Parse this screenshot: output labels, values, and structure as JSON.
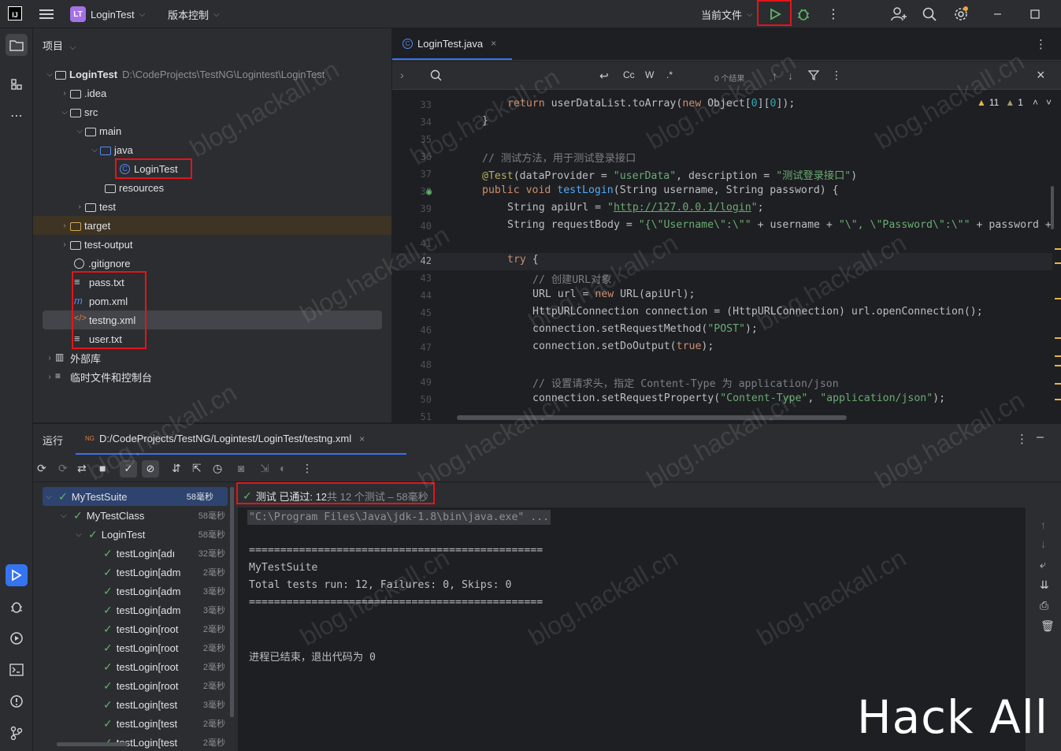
{
  "titlebar": {
    "project_badge": "LT",
    "project_name": "LoginTest",
    "vcs": "版本控制",
    "run_config": "当前文件"
  },
  "project": {
    "title": "项目",
    "tree": [
      {
        "label": "LoginTest",
        "path": "D:\\CodeProjects\\TestNG\\Logintest\\LoginTest"
      },
      {
        "label": ".idea"
      },
      {
        "label": "src"
      },
      {
        "label": "main"
      },
      {
        "label": "java"
      },
      {
        "label": "LoginTest"
      },
      {
        "label": "resources"
      },
      {
        "label": "test"
      },
      {
        "label": "target"
      },
      {
        "label": "test-output"
      },
      {
        "label": ".gitignore"
      },
      {
        "label": "pass.txt"
      },
      {
        "label": "pom.xml"
      },
      {
        "label": "testng.xml"
      },
      {
        "label": "user.txt"
      },
      {
        "label": "外部库"
      },
      {
        "label": "临时文件和控制台"
      }
    ]
  },
  "editor": {
    "tab": "LoginTest.java",
    "find": {
      "cc": "Cc",
      "w": "W",
      "regex": ".*",
      "results": "0 个结果"
    },
    "inspections": {
      "warnings": "11",
      "weak": "1"
    },
    "line_numbers": [
      "33",
      "34",
      "35",
      "36",
      "37",
      "38",
      "39",
      "40",
      "41",
      "42",
      "43",
      "44",
      "45",
      "46",
      "47",
      "48",
      "49",
      "50",
      "51"
    ],
    "lines": {
      "l33_a": "return",
      "l33_b": " userDataList.toArray(",
      "l33_c": "new",
      "l33_d": " Object[",
      "l33_e": "0",
      "l33_f": "][",
      "l33_g": "0",
      "l33_h": "]);",
      "l34": "}",
      "l36": "// 测试方法，用于测试登录接口",
      "l37_a": "@Test",
      "l37_b": "(dataProvider = ",
      "l37_c": "\"userData\"",
      "l37_d": ", description = ",
      "l37_e": "\"测试登录接口\"",
      "l37_f": ")",
      "l38_a": "public void ",
      "l38_b": "testLogin",
      "l38_c": "(String username, String password) {",
      "l39_a": "String apiUrl = ",
      "l39_b": "\"",
      "l39_c": "http://127.0.0.1/login",
      "l39_d": "\"",
      "l39_e": ";",
      "l40_a": "String requestBody = ",
      "l40_b": "\"{\\\"Username\\\":\\\"\"",
      "l40_c": " + username + ",
      "l40_d": "\"\\\", \\\"Password\\\":\\\"\"",
      "l40_e": " + password +",
      "l42_a": "try",
      "l42_b": " {",
      "l43": "// 创建URL对象",
      "l44_a": "URL url = ",
      "l44_b": "new",
      "l44_c": " URL(apiUrl);",
      "l45": "HttpURLConnection connection = (HttpURLConnection) url.openConnection();",
      "l46_a": "connection.setRequestMethod(",
      "l46_b": "\"POST\"",
      "l46_c": ");",
      "l47_a": "connection.setDoOutput(",
      "l47_b": "true",
      "l47_c": ");",
      "l49": "// 设置请求头，指定 Content-Type 为 application/json",
      "l50_a": "connection.setRequestProperty(",
      "l50_b": "\"Content-Type\"",
      "l50_c": ", ",
      "l50_d": "\"application/json\"",
      "l50_e": ");"
    }
  },
  "run": {
    "title": "运行",
    "tab": "D:/CodeProjects/TestNG/Logintest/LoginTest/testng.xml",
    "tree": [
      {
        "label": "MyTestSuite",
        "time": "58毫秒"
      },
      {
        "label": "MyTestClass",
        "time": "58毫秒"
      },
      {
        "label": "LoginTest",
        "time": "58毫秒"
      },
      {
        "label": "testLogin[adı",
        "time": "32毫秒"
      },
      {
        "label": "testLogin[adm",
        "time": "2毫秒"
      },
      {
        "label": "testLogin[adm",
        "time": "3毫秒"
      },
      {
        "label": "testLogin[adm",
        "time": "3毫秒"
      },
      {
        "label": "testLogin[root",
        "time": "2毫秒"
      },
      {
        "label": "testLogin[root",
        "time": "2毫秒"
      },
      {
        "label": "testLogin[root",
        "time": "2毫秒"
      },
      {
        "label": "testLogin[root",
        "time": "2毫秒"
      },
      {
        "label": "testLogin[test",
        "time": "3毫秒"
      },
      {
        "label": "testLogin[test",
        "time": "2毫秒"
      },
      {
        "label": "testLogin[test",
        "time": "2毫秒"
      }
    ],
    "status": {
      "prefix": "测试 已通过: 12",
      "rest": "共 12 个测试 – 58毫秒"
    },
    "console": [
      "\"C:\\Program Files\\Java\\jdk-1.8\\bin\\java.exe\" ...",
      "===============================================",
      "MyTestSuite",
      "Total tests run: 12, Failures: 0, Skips: 0",
      "===============================================",
      "进程已结束，退出代码为 0"
    ]
  },
  "watermark": "blog.hackall.cn",
  "brand": "Hack All",
  "colors": {
    "accent": "#3574f0",
    "pass": "#5fb865",
    "highlight_box": "#e5141a"
  }
}
